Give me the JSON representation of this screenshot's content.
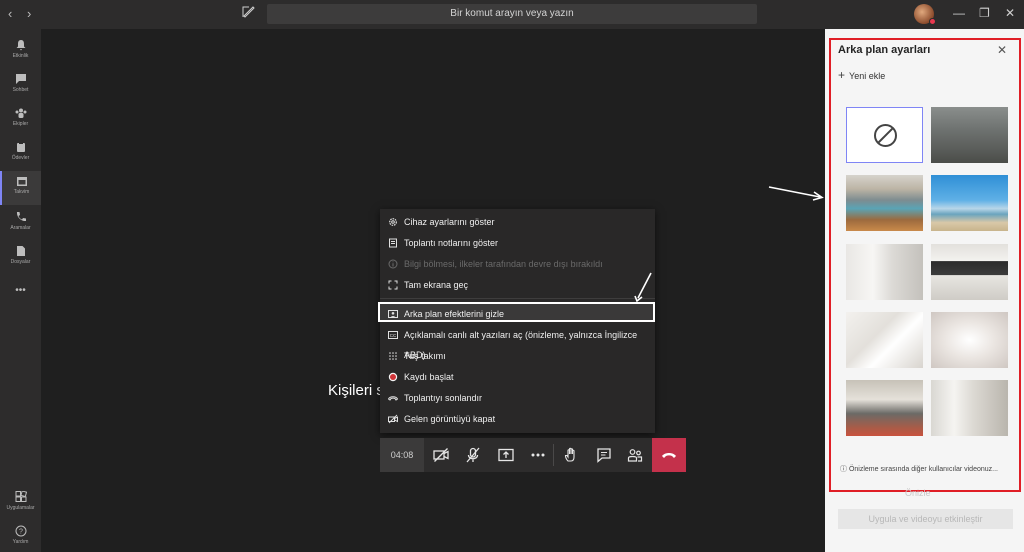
{
  "titlebar": {
    "search_placeholder": "Bir komut arayın veya yazın",
    "back": "‹",
    "forward": "›",
    "minimize": "—",
    "restore": "❐",
    "close": "✕"
  },
  "rail": {
    "items": [
      {
        "label": "Etkinlik",
        "icon": "bell-icon"
      },
      {
        "label": "Sohbet",
        "icon": "chat-icon"
      },
      {
        "label": "Ekipler",
        "icon": "teams-icon"
      },
      {
        "label": "Ödevler",
        "icon": "assignments-icon"
      },
      {
        "label": "Takvim",
        "icon": "calendar-icon",
        "active": true
      },
      {
        "label": "Aramalar",
        "icon": "phone-icon"
      },
      {
        "label": "Dosyalar",
        "icon": "files-icon"
      }
    ],
    "more": "•••",
    "apps_label": "Uygulamalar",
    "help_label": "Yardım"
  },
  "stage": {
    "partial_text": "Kişileri s"
  },
  "menu": {
    "items": [
      {
        "label": "Cihaz ayarlarını göster",
        "icon": "gear-icon"
      },
      {
        "label": "Toplantı notlarını göster",
        "icon": "notes-icon"
      },
      {
        "label": "Bilgi bölmesi, ilkeler tarafından devre dışı bırakıldı",
        "icon": "info-icon",
        "disabled": true
      },
      {
        "label": "Tam ekrana geç",
        "icon": "fullscreen-icon"
      },
      {
        "label": "Arka plan efektlerini gizle",
        "icon": "background-effects-icon",
        "selected": true
      },
      {
        "label": "Açıklamalı canlı alt yazıları aç (önizleme, yalnızca İngilizce ABD)",
        "icon": "captions-icon"
      },
      {
        "label": "Tuş takımı",
        "icon": "keypad-icon"
      },
      {
        "label": "Kaydı başlat",
        "icon": "record-icon"
      },
      {
        "label": "Toplantıyı sonlandır",
        "icon": "end-meeting-icon"
      },
      {
        "label": "Gelen görüntüyü kapat",
        "icon": "video-off-icon"
      }
    ]
  },
  "callbar": {
    "timer": "04:08"
  },
  "panel": {
    "title": "Arka plan ayarları",
    "close": "✕",
    "add_new": "Yeni ekle",
    "footer_note": "Önizleme sırasında diğer kullanıcılar videonuz...",
    "preview_label": "Önizle",
    "apply_label": "Uygula ve videoyu etkinleştir"
  },
  "colors": {
    "accent": "#7f85f5",
    "hangup": "#c4314b",
    "highlight_border": "#e01e26"
  }
}
